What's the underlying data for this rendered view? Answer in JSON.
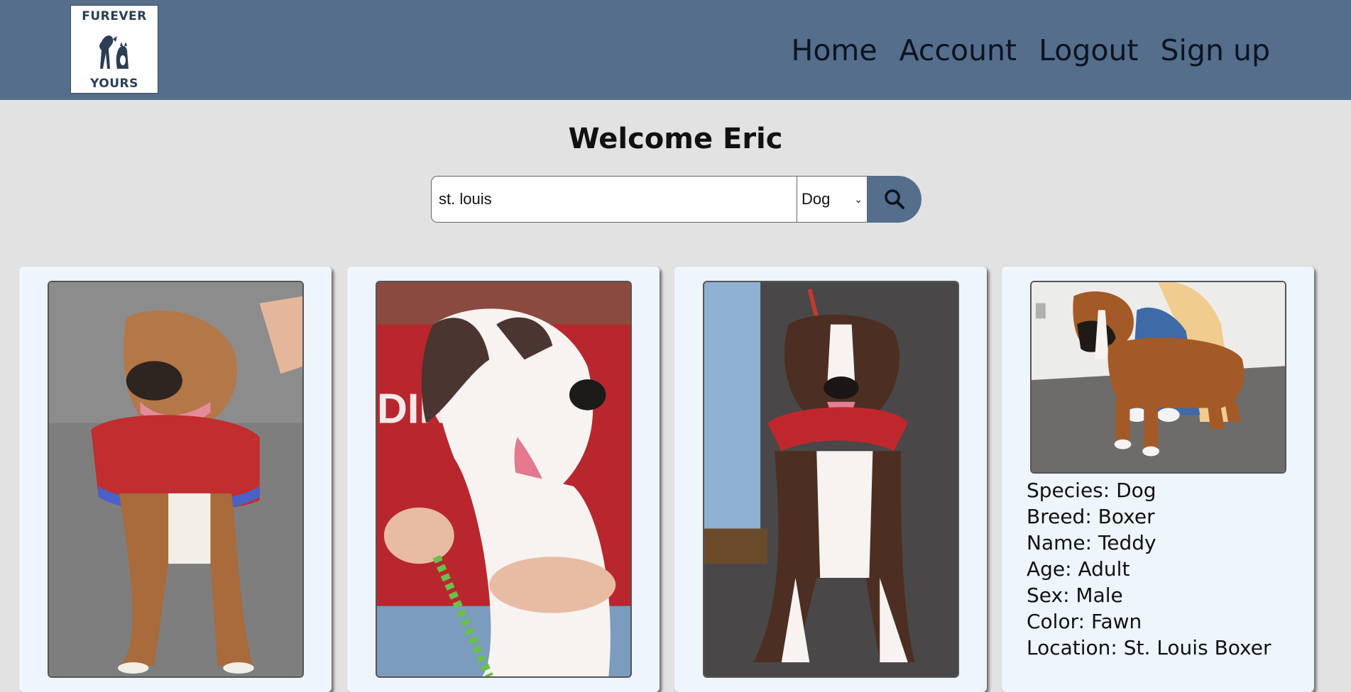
{
  "logo": {
    "top_text": "FUREVER",
    "bottom_text": "YOURS"
  },
  "nav": {
    "links": [
      "Home",
      "Account",
      "Logout",
      "Sign up"
    ]
  },
  "welcome": "Welcome Eric",
  "search": {
    "value": "st. louis",
    "species_selected": "Dog"
  },
  "cards": [
    {
      "photo": "boxer-puppy-red-bandana"
    },
    {
      "photo": "white-brindle-dog-red-shirt"
    },
    {
      "photo": "brindle-boxer-sitting"
    },
    {
      "photo": "boxer-standing-with-owner",
      "species": "Species: Dog",
      "breed": "Breed: Boxer",
      "name": "Name: Teddy",
      "age": "Age: Adult",
      "sex": "Sex: Male",
      "color": "Color: Fawn",
      "location": "Location: St. Louis Boxer"
    }
  ]
}
